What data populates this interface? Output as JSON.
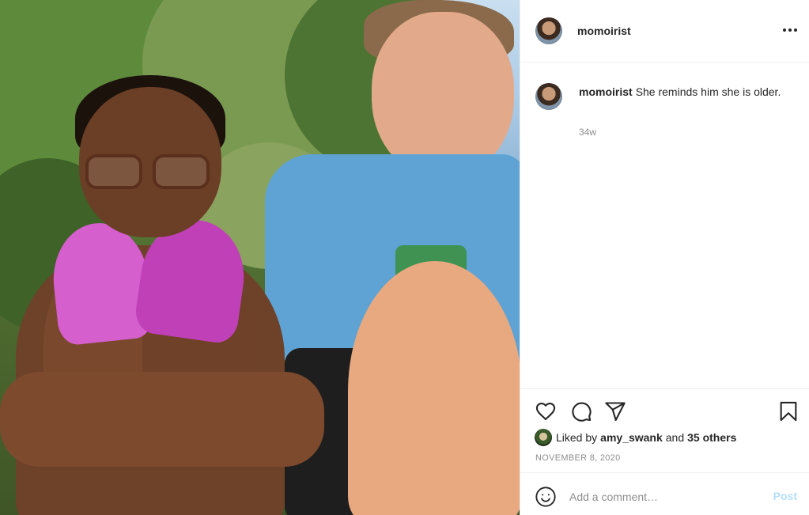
{
  "post": {
    "image_alt": "Two kids sitting outdoors",
    "author": {
      "username": "momoirist"
    },
    "caption": {
      "username": "momoirist",
      "text": "She reminds him she is older."
    },
    "time_ago": "34w",
    "likes": {
      "prefix": "Liked by",
      "first_user": "amy_swank",
      "conjunction": "and",
      "others": "35 others"
    },
    "date": "NOVEMBER 8, 2020"
  },
  "comment_box": {
    "placeholder": "Add a comment…",
    "post_label": "Post"
  },
  "icons": {
    "more": "more-options-icon",
    "like": "heart-icon",
    "comment": "comment-icon",
    "share": "share-icon",
    "save": "bookmark-icon",
    "emoji": "emoji-icon"
  },
  "colors": {
    "text": "#262626",
    "secondary": "#8e8e8e",
    "border": "#efefef",
    "post_button_disabled": "#b2dffc"
  }
}
